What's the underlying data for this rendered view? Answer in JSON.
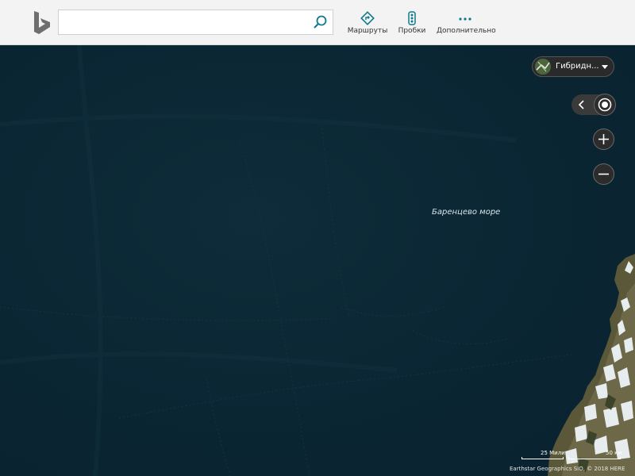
{
  "header": {
    "search": {
      "value": "",
      "placeholder": ""
    },
    "nav": {
      "routes": {
        "label": "Маршруты",
        "icon": "directions-icon"
      },
      "traffic": {
        "label": "Пробки",
        "icon": "traffic-light-icon"
      },
      "more": {
        "label": "Дополнительно",
        "icon": "more-dots-icon"
      }
    }
  },
  "map": {
    "sea_label": "Баренцево море",
    "map_type": "Гибридн...",
    "scale_miles": "25 Мили",
    "scale_km": "50 км",
    "attribution": "Earthstar Geographics SIO, © 2018 HERE"
  },
  "colors": {
    "accent": "#0e7a8a",
    "sea": "#0b2633",
    "header_bg": "#f3f3f3"
  }
}
